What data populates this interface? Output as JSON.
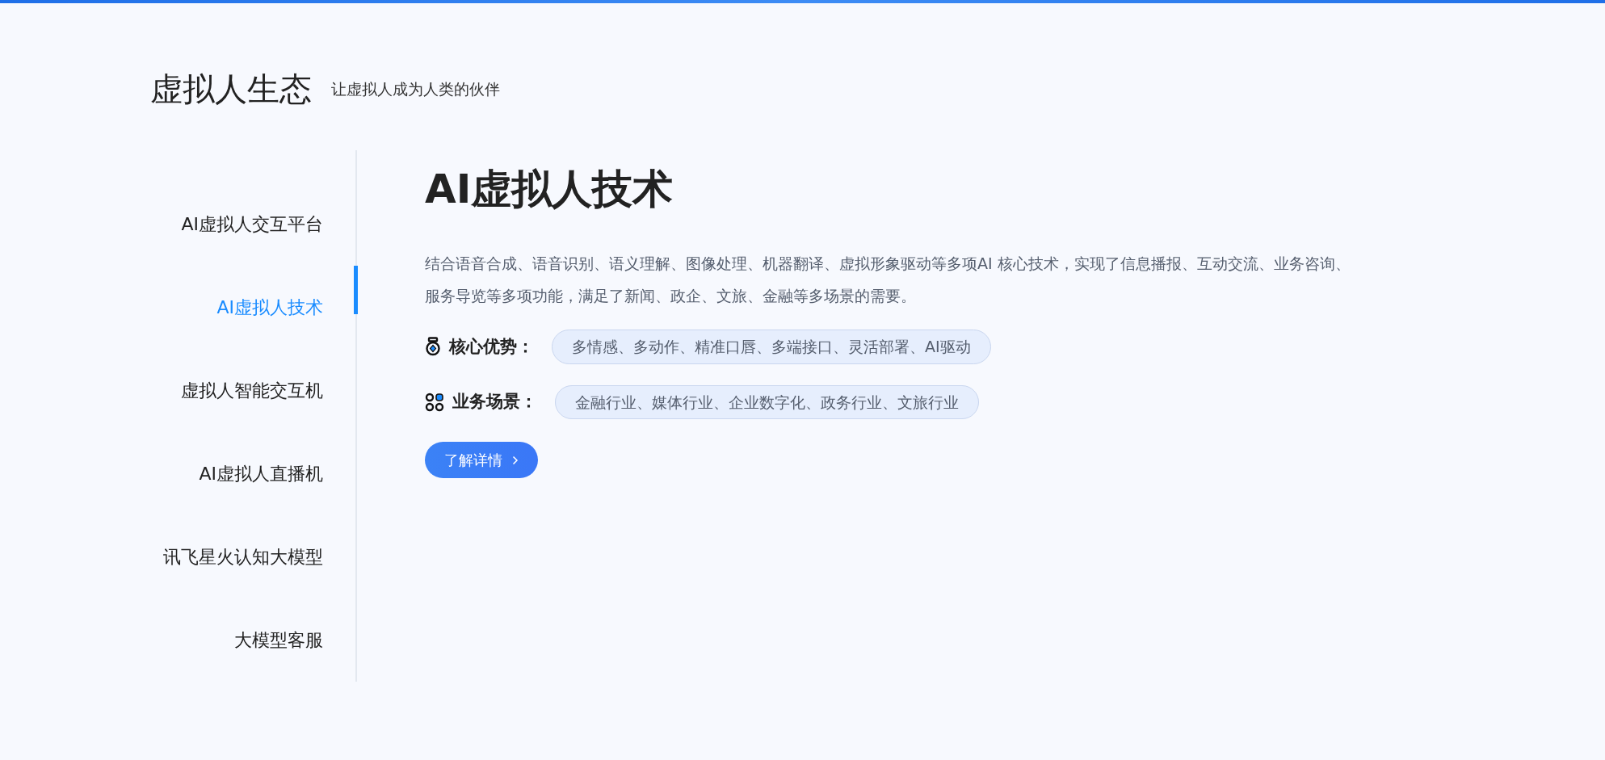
{
  "header": {
    "title": "虚拟人生态",
    "subtitle": "让虚拟人成为人类的伙伴"
  },
  "sidebar": {
    "items": [
      {
        "label": "AI虚拟人交互平台",
        "selected": false
      },
      {
        "label": "AI虚拟人技术",
        "selected": true
      },
      {
        "label": "虚拟人智能交互机",
        "selected": false
      },
      {
        "label": "AI虚拟人直播机",
        "selected": false
      },
      {
        "label": "讯飞星火认知大模型",
        "selected": false
      },
      {
        "label": "大模型客服",
        "selected": false
      }
    ]
  },
  "content": {
    "title": "AI虚拟人技术",
    "description": "结合语音合成、语音识别、语义理解、图像处理、机器翻译、虚拟形象驱动等多项AI 核心技术，实现了信息播报、互动交流、业务咨询、服务导览等多项功能，满足了新闻、政企、文旅、金融等多场景的需要。",
    "features": [
      {
        "kind": "medal",
        "label": "核心优势：",
        "value": "多情感、多动作、精准口唇、多端接口、灵活部署、AI驱动"
      },
      {
        "kind": "grid",
        "label": "业务场景：",
        "value": "金融行业、媒体行业、企业数字化、政务行业、文旅行业"
      }
    ],
    "button": {
      "label": "了解详情"
    }
  }
}
